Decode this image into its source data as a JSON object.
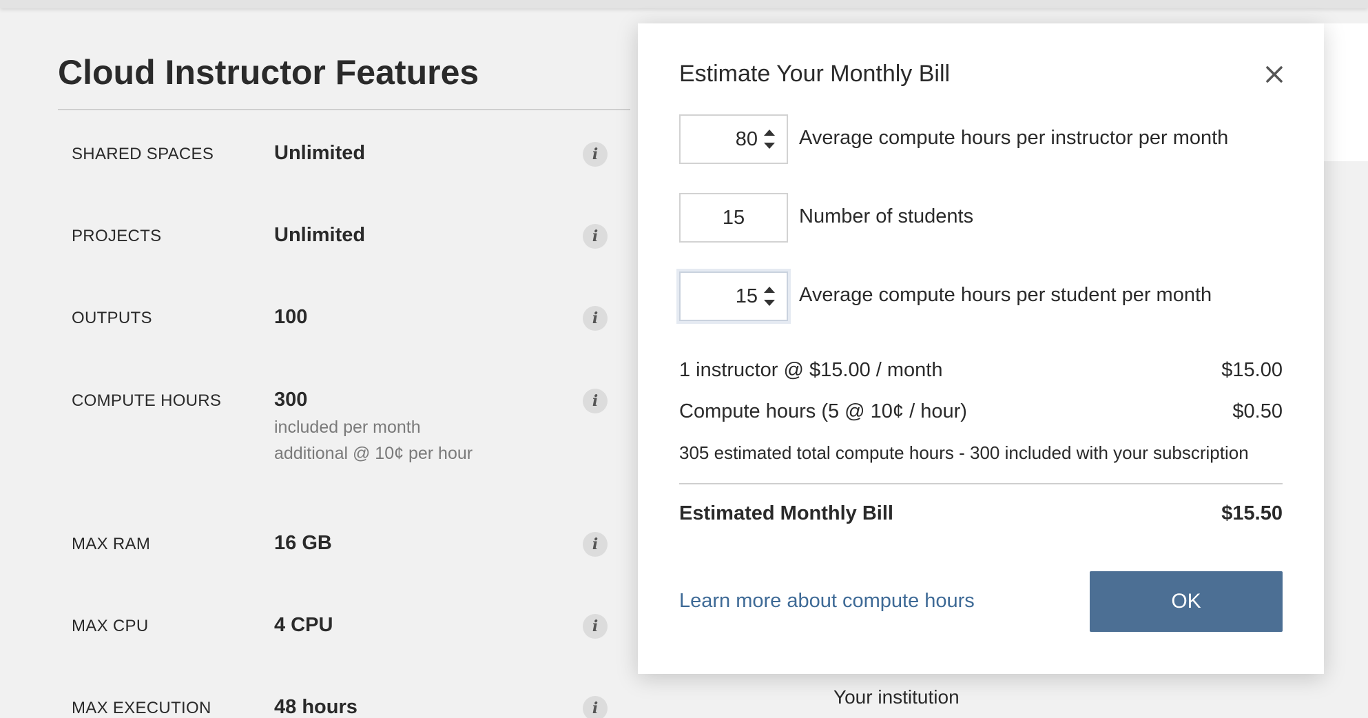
{
  "features": {
    "title": "Cloud Instructor Features",
    "rows": [
      {
        "label": "SHARED SPACES",
        "value": "Unlimited"
      },
      {
        "label": "PROJECTS",
        "value": "Unlimited"
      },
      {
        "label": "OUTPUTS",
        "value": "100"
      },
      {
        "label": "COMPUTE HOURS",
        "value": "300",
        "note1": "included per month",
        "note2": "additional @ 10¢ per hour"
      },
      {
        "label": "MAX RAM",
        "value": "16 GB"
      },
      {
        "label": "MAX CPU",
        "value": "4 CPU"
      },
      {
        "label": "MAX EXECUTION",
        "value": "48 hours"
      }
    ],
    "info_glyph": "i"
  },
  "background": {
    "institution_text": "Your institution"
  },
  "modal": {
    "title": "Estimate Your Monthly Bill",
    "close_glyph": "✕",
    "fields": [
      {
        "value": "80",
        "label": "Average compute hours per instructor per month"
      },
      {
        "value": "15",
        "label": "Number of students"
      },
      {
        "value": "15",
        "label": "Average compute hours per student per month"
      }
    ],
    "line_items": [
      {
        "label": "1 instructor @ $15.00 / month",
        "amount": "$15.00"
      },
      {
        "label": "Compute hours (5 @ 10¢ / hour)",
        "amount": "$0.50"
      }
    ],
    "note": "305 estimated total compute hours - 300 included with your subscription",
    "total": {
      "label": "Estimated Monthly Bill",
      "amount": "$15.50"
    },
    "learn_link": "Learn more about compute hours",
    "ok_label": "OK"
  },
  "colors": {
    "accent_button": "#4c6f94",
    "link": "#3e6a96",
    "page_background": "#f1f1f1"
  },
  "icons": {
    "info": "info-icon",
    "close": "close-icon",
    "spinner": "spinner-arrows-icon"
  }
}
